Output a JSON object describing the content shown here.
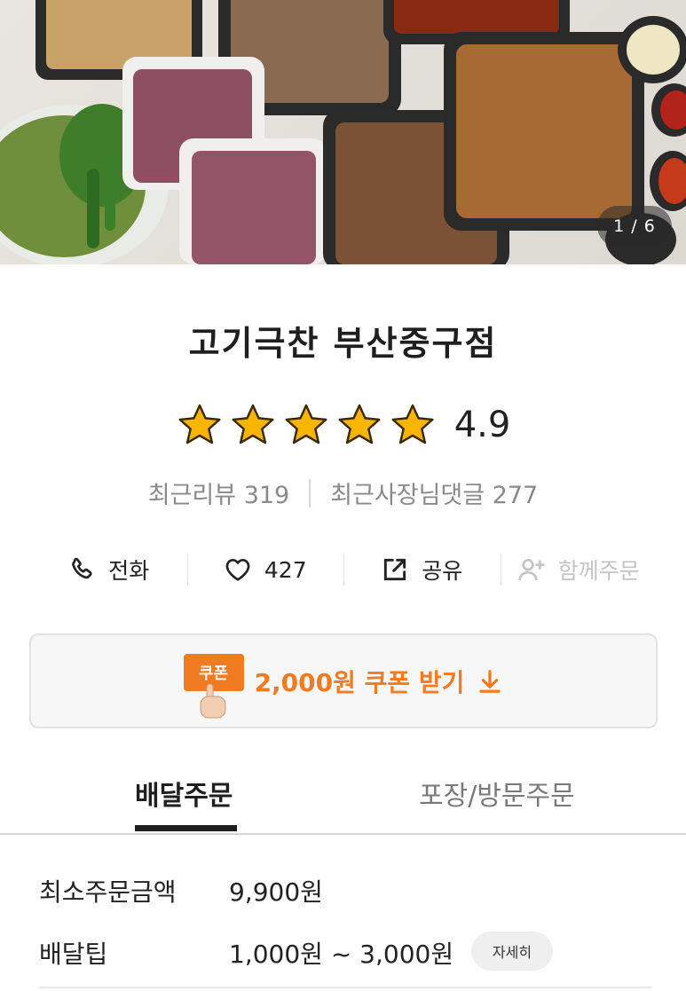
{
  "hero": {
    "page_indicator": "1 / 6"
  },
  "store": {
    "name": "고기극찬 부산중구점"
  },
  "rating": {
    "value": "4.9",
    "stars": 5
  },
  "reviews": {
    "recent_reviews": "최근리뷰 319",
    "owner_comments": "최근사장님댓글 277"
  },
  "actions": {
    "call": {
      "label": "전화",
      "icon": "phone-icon"
    },
    "like": {
      "label": "427",
      "icon": "heart-icon"
    },
    "share": {
      "label": "공유",
      "icon": "share-icon"
    },
    "group_order": {
      "label": "함께주문",
      "icon": "add-person-icon"
    }
  },
  "coupon": {
    "badge": "쿠폰",
    "text": "2,000원 쿠폰 받기",
    "color": "#f07b21"
  },
  "tabs": {
    "delivery": "배달주문",
    "pickup": "포장/방문주문"
  },
  "order_info": {
    "min_order_label": "최소주문금액",
    "min_order_value": "9,900원",
    "delivery_tip_label": "배달팁",
    "delivery_tip_value": "1,000원 ~ 3,000원",
    "detail_button": "자세히"
  }
}
